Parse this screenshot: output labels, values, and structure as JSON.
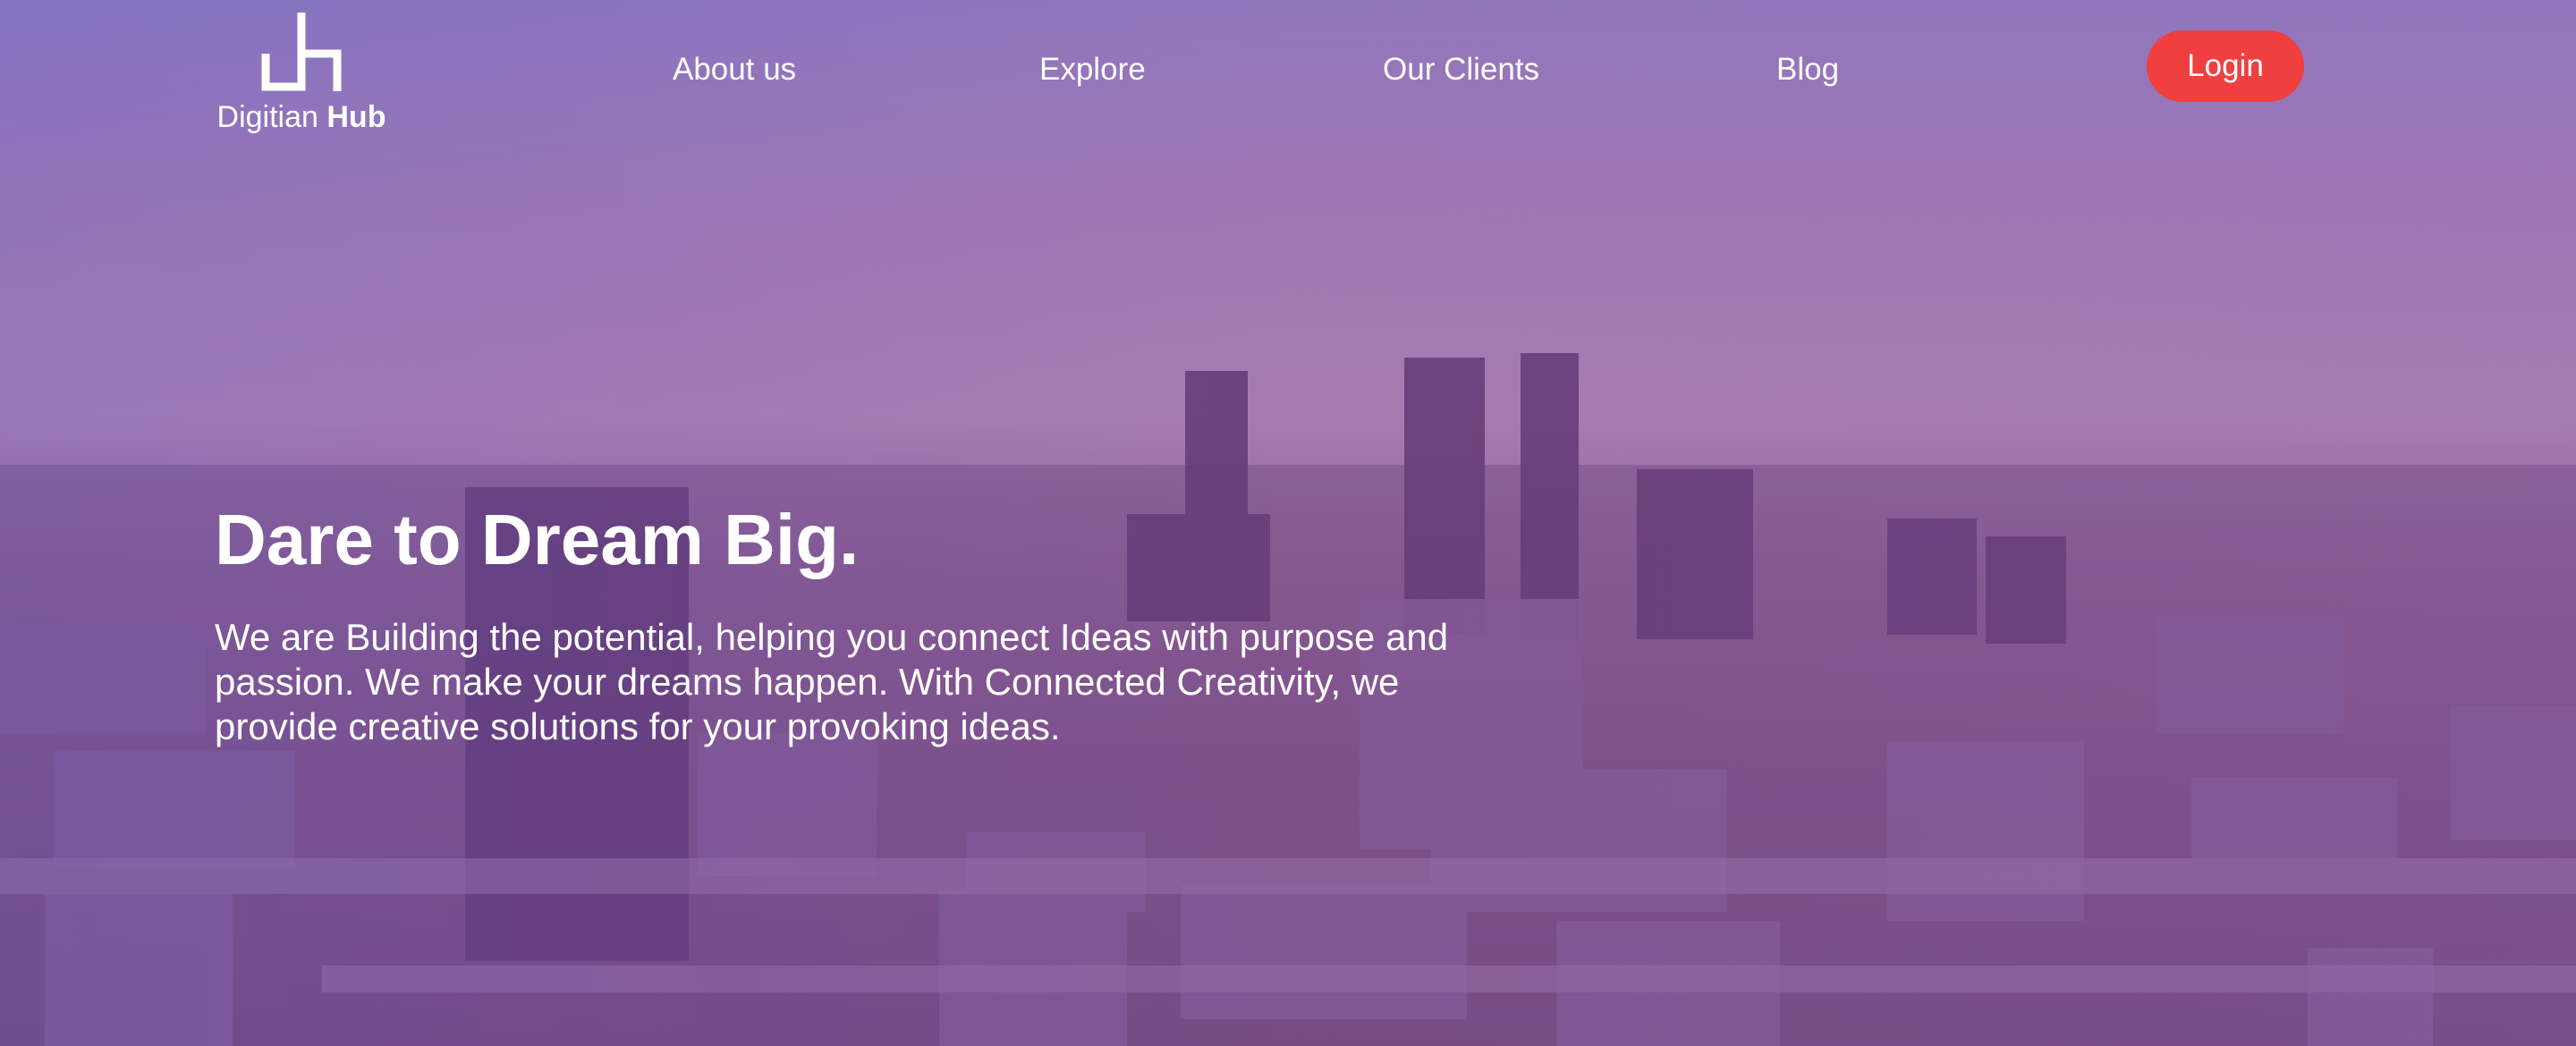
{
  "brand": {
    "name_regular": "Digitian",
    "name_bold": "Hub",
    "logo_icon": "dh-monogram-icon"
  },
  "nav": {
    "items": [
      {
        "label": "About us"
      },
      {
        "label": "Explore"
      },
      {
        "label": "Our Clients"
      },
      {
        "label": "Blog"
      }
    ],
    "login_label": "Login"
  },
  "hero": {
    "title": "Dare to Dream Big.",
    "body": "We are Building the potential, helping you connect Ideas with purpose and passion. We make your dreams happen. With Connected Creativity, we provide creative solutions for your provoking ideas."
  },
  "colors": {
    "accent": "#f03f3f",
    "text": "#ffffff",
    "overlay": "#8f62a8"
  }
}
